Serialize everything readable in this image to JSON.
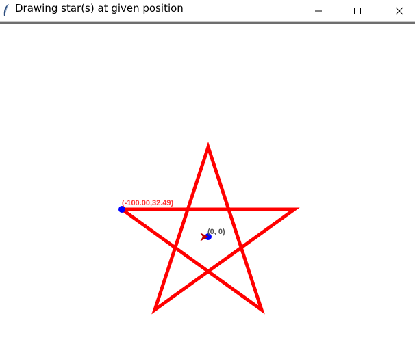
{
  "window": {
    "title": "Drawing star(s) at given position",
    "app_icon": "feather-icon",
    "controls": [
      "minimize-icon",
      "maximize-icon",
      "close-icon"
    ]
  },
  "canvas": {
    "background": "#ffffff",
    "star": {
      "color": "#ff0000",
      "points": 5
    },
    "markers": [
      {
        "label": "(-100.00,32.49)",
        "label_color": "#ff3333",
        "dot_color": "#0000ff"
      },
      {
        "label": "(0, 0)",
        "label_color": "#555555",
        "dot_color": "#0000ff"
      }
    ],
    "turtle": {
      "color": "#c00000"
    }
  }
}
